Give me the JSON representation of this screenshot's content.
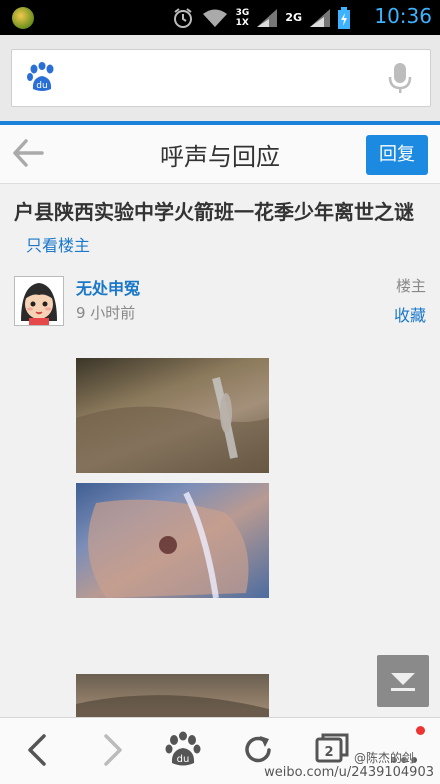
{
  "status_bar": {
    "time": "10:36",
    "network_3g": "3G",
    "network_1x": "1X",
    "network_2g": "2G",
    "icons": [
      "app-icon",
      "alarm-icon",
      "wifi-icon",
      "signal-icon",
      "battery-icon"
    ]
  },
  "search": {
    "placeholder": "",
    "logo_text": "du"
  },
  "header": {
    "title": "呼声与回应",
    "reply_label": "回复"
  },
  "post": {
    "title": "户县陕西实验中学火箭班一花季少年离世之谜",
    "only_op_label": "只看楼主",
    "author": "无处申冤",
    "time": "9 小时前",
    "op_tag": "楼主",
    "favorite_label": "收藏"
  },
  "toolbar": {
    "tab_count": "2",
    "logo_text": "du"
  },
  "watermark": "weibo.com/u/2439104903",
  "watermark_name": "@陈杰的剑",
  "colors": {
    "accent": "#1b8ae0",
    "link": "#1a78c9",
    "clock": "#3db2ff"
  }
}
